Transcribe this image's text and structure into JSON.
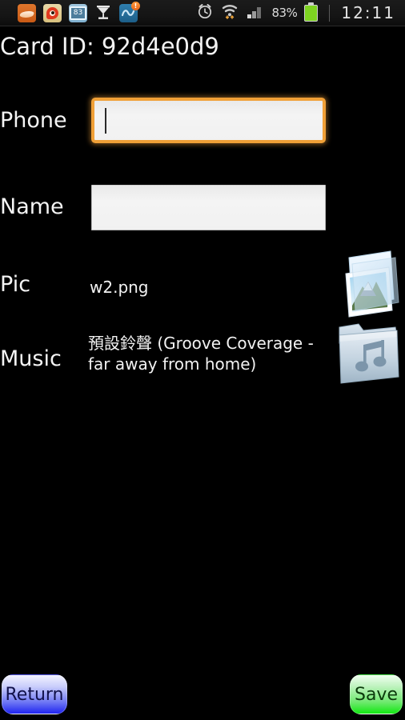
{
  "status_bar": {
    "notification_icons": [
      {
        "name": "swipe-keyboard-icon",
        "label": ""
      },
      {
        "name": "weibo-icon",
        "label": ""
      },
      {
        "name": "battery-widget-icon",
        "label": "83"
      },
      {
        "name": "hourglass-icon",
        "label": ""
      },
      {
        "name": "cloud-sync-icon",
        "label": "!"
      }
    ],
    "alarm_icon": "alarm-clock-icon",
    "wifi_icon": "wifi-icon",
    "signal_icon": "cellular-signal-icon",
    "battery_percent": "83%",
    "battery_icon": "battery-icon",
    "clock": "12:11"
  },
  "page": {
    "title": "Card ID: 92d4e0d9"
  },
  "fields": {
    "phone": {
      "label": "Phone",
      "value": "",
      "placeholder": "",
      "focused": true
    },
    "name": {
      "label": "Name",
      "value": "",
      "placeholder": "",
      "focused": false
    },
    "pic": {
      "label": "Pic",
      "value": "w2.png",
      "icon": "picture-folder-icon"
    },
    "music": {
      "label": "Music",
      "value": "預設鈴聲 (Groove Coverage - far away from home)",
      "icon": "music-folder-icon"
    }
  },
  "footer": {
    "return_label": "Return",
    "save_label": "Save"
  },
  "colors": {
    "background": "#000000",
    "focus_border": "#f0a037",
    "return_accent": "#1f24f0",
    "save_accent": "#12e812",
    "battery_green": "#7ed321"
  }
}
